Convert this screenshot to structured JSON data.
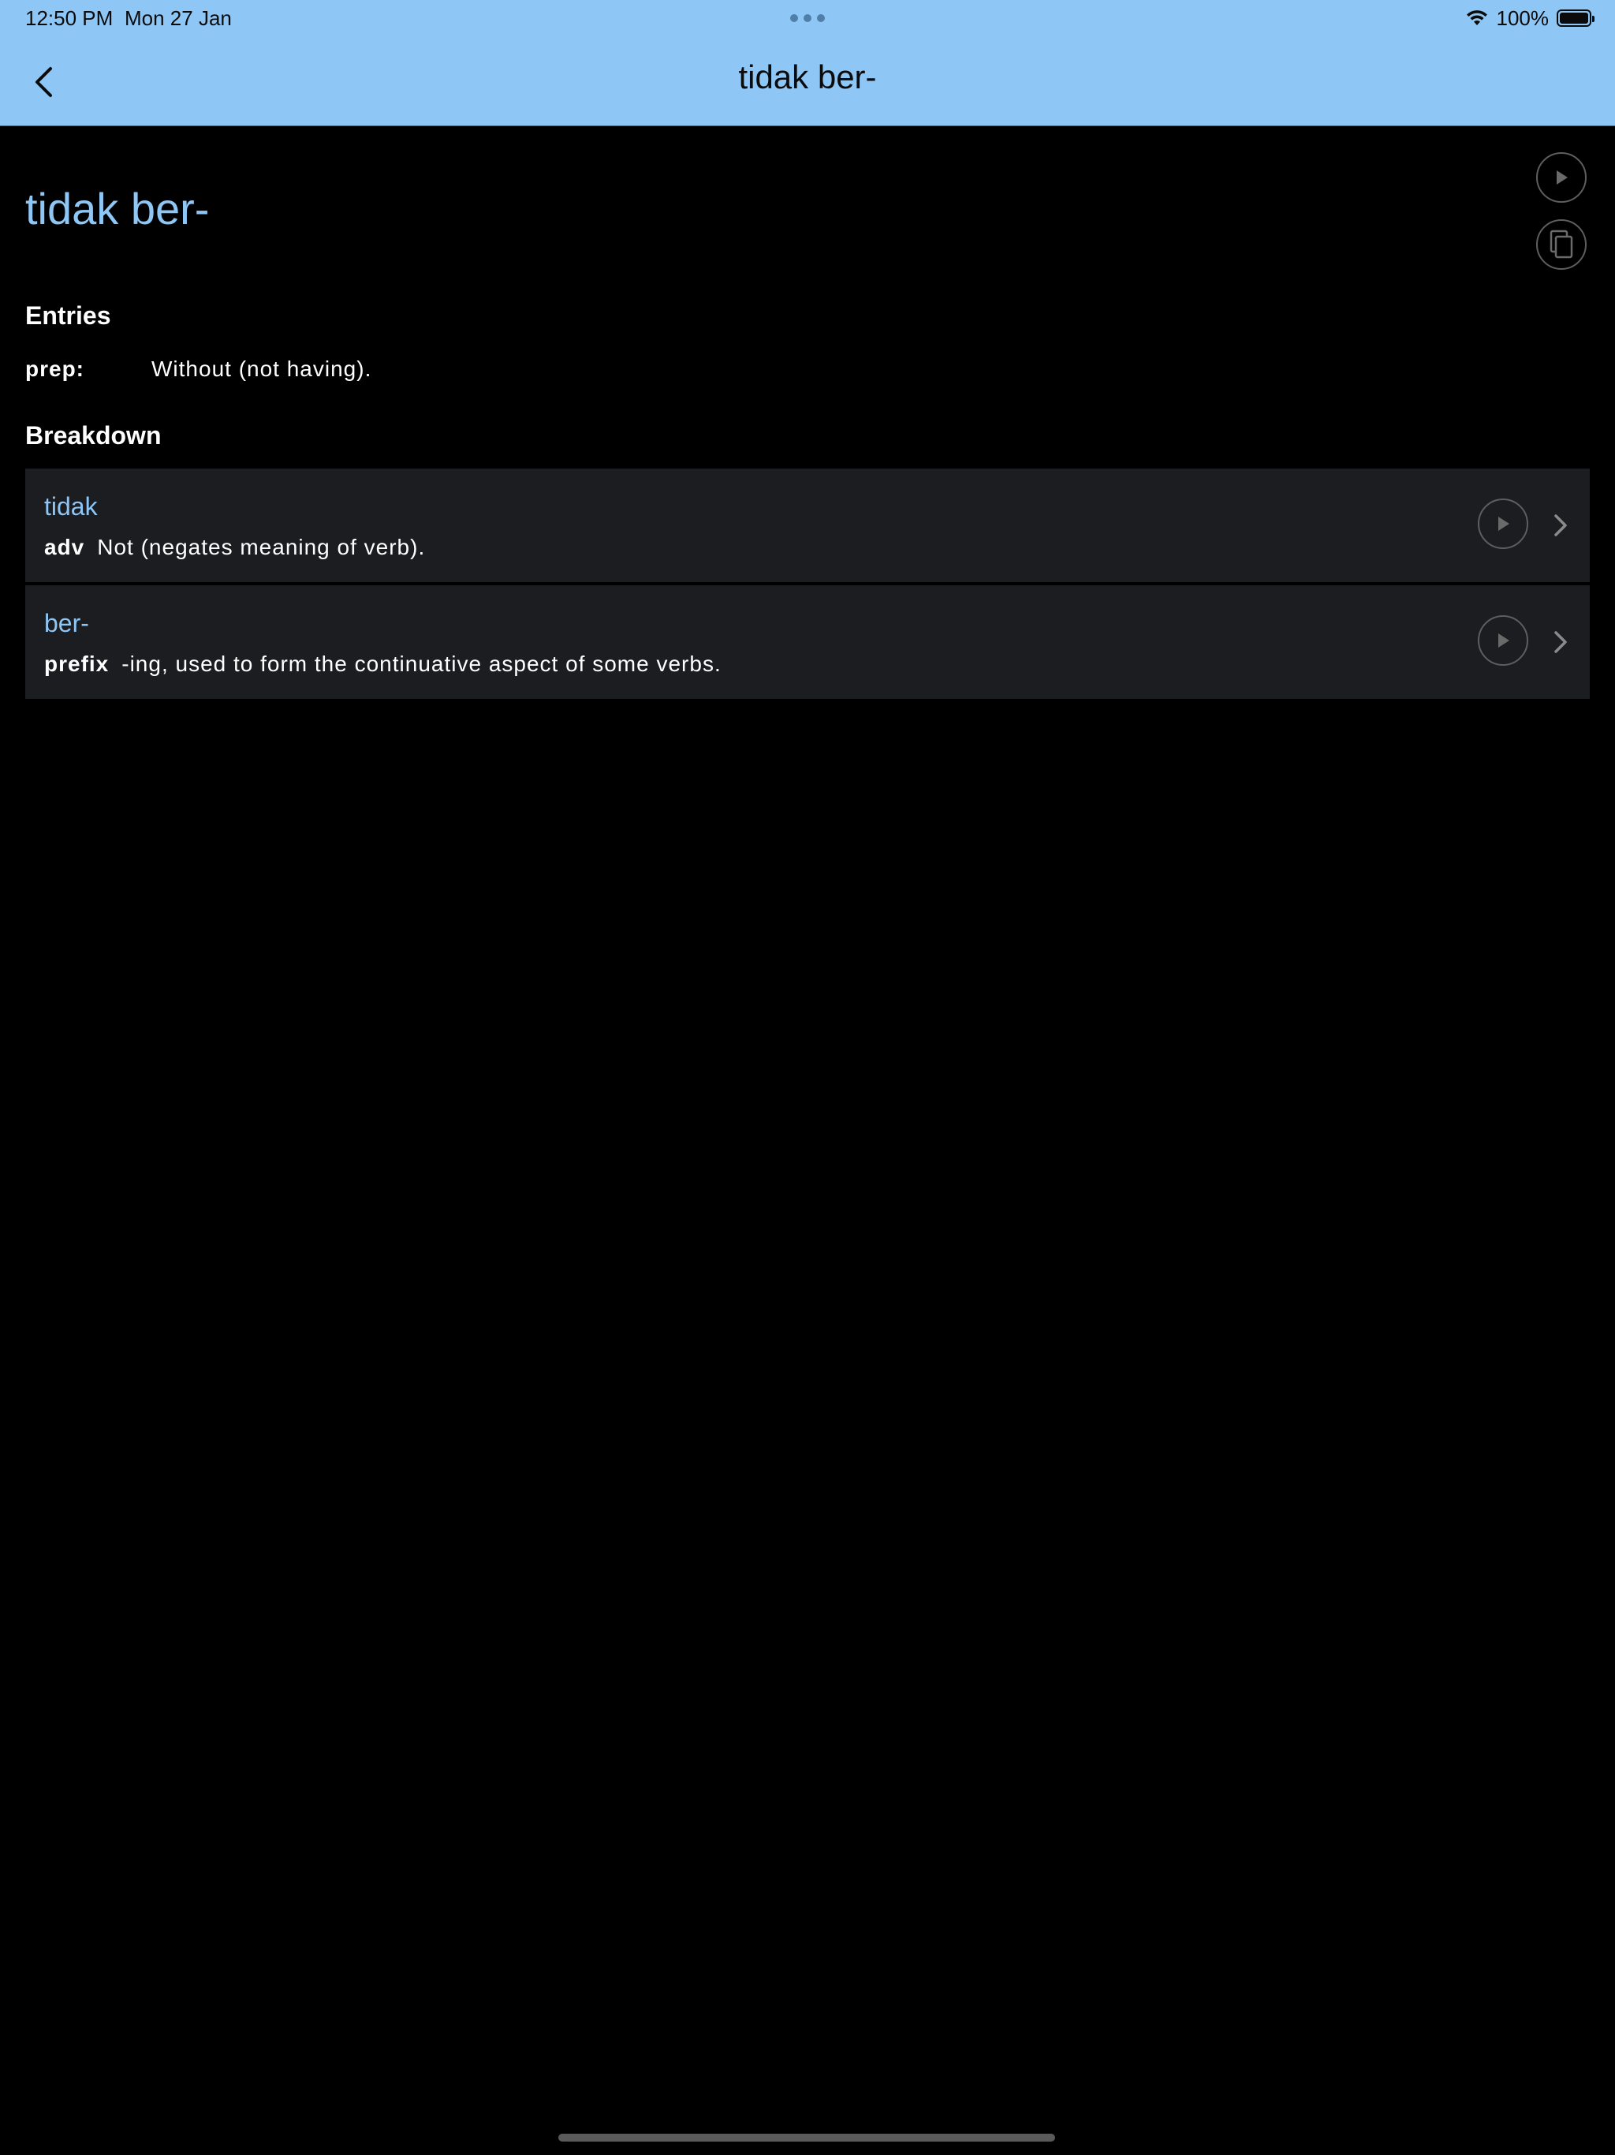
{
  "status_bar": {
    "time": "12:50 PM",
    "date": "Mon 27 Jan",
    "battery": "100%"
  },
  "nav": {
    "title": "tidak ber-"
  },
  "word": {
    "title": "tidak ber-"
  },
  "sections": {
    "entries": "Entries",
    "breakdown": "Breakdown"
  },
  "entries": [
    {
      "pos": "prep:",
      "definition": "Without (not having)."
    }
  ],
  "breakdown": [
    {
      "word": "tidak",
      "pos": "adv",
      "definition": "Not (negates meaning of verb)."
    },
    {
      "word": "ber-",
      "pos": "prefix",
      "definition": "-ing, used to form the continuative aspect of some verbs."
    }
  ],
  "icons": {
    "back": "chevron-left-icon",
    "play": "play-icon",
    "copy": "copy-icon",
    "forward": "chevron-right-icon",
    "wifi": "wifi-icon",
    "battery": "battery-icon"
  },
  "colors": {
    "header_bg": "#8ec7f6",
    "accent_text": "#8ec7f6",
    "background": "#000000",
    "card_bg": "#1c1d21"
  }
}
